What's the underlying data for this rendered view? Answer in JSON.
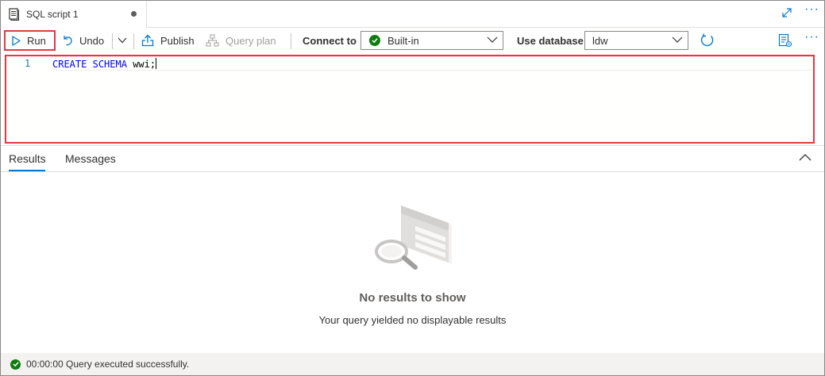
{
  "tab": {
    "title": "SQL script 1"
  },
  "toolbar": {
    "run_label": "Run",
    "undo_label": "Undo",
    "publish_label": "Publish",
    "query_plan_label": "Query plan",
    "connect_to_label": "Connect to",
    "connect_to_value": "Built-in",
    "use_database_label": "Use database",
    "use_database_value": "ldw"
  },
  "editor": {
    "line_number": "1",
    "keyword1": "CREATE",
    "keyword2": "SCHEMA",
    "identifier": "wwi;"
  },
  "results": {
    "tabs": [
      "Results",
      "Messages"
    ],
    "active_tab": "Results",
    "empty_title": "No results to show",
    "empty_subtitle": "Your query yielded no displayable results"
  },
  "status": {
    "text": "00:00:00 Query executed successfully."
  },
  "colors": {
    "accent": "#0078d4",
    "success": "#107c10",
    "highlight_box": "#e8383d",
    "keyword": "#0000ff"
  },
  "icons": [
    "document-icon",
    "expand-icon",
    "more-icon",
    "run-icon",
    "undo-icon",
    "chevron-down-icon",
    "publish-icon",
    "query-plan-icon",
    "check-icon",
    "refresh-icon",
    "properties-icon",
    "chevron-up-icon",
    "search-illustration"
  ]
}
